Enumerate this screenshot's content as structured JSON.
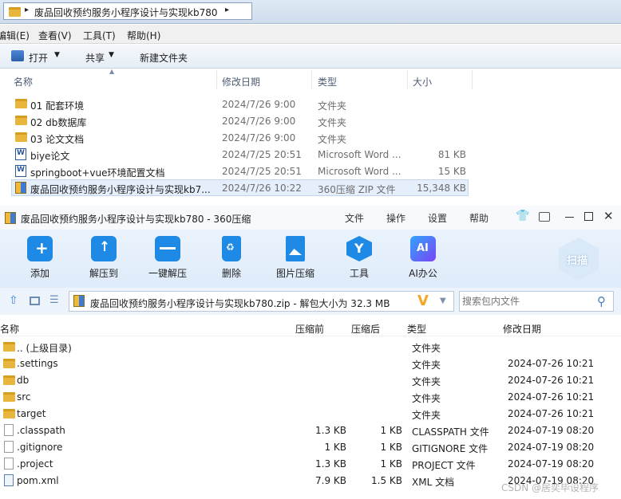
{
  "explorer": {
    "breadcrumb": "废品回收预约服务小程序设计与实现kb780",
    "menu": [
      "编辑(E)",
      "查看(V)",
      "工具(T)",
      "帮助(H)"
    ],
    "commands": {
      "open": "打开",
      "share": "共享",
      "new_folder": "新建文件夹"
    },
    "columns": {
      "name": "名称",
      "date": "修改日期",
      "type": "类型",
      "size": "大小"
    },
    "rows": [
      {
        "name": "01 配套环境",
        "date": "2024/7/26 9:00",
        "type": "文件夹",
        "size": "",
        "icon": "folder-icon"
      },
      {
        "name": "02 db数据库",
        "date": "2024/7/26 9:00",
        "type": "文件夹",
        "size": "",
        "icon": "folder-icon"
      },
      {
        "name": "03 论文文档",
        "date": "2024/7/26 9:00",
        "type": "文件夹",
        "size": "",
        "icon": "folder-icon"
      },
      {
        "name": "biye论文",
        "date": "2024/7/25 20:51",
        "type": "Microsoft Word ...",
        "size": "81 KB",
        "icon": "word-doc-icon"
      },
      {
        "name": "springboot+vue环境配置文档",
        "date": "2024/7/25 20:51",
        "type": "Microsoft Word ...",
        "size": "15 KB",
        "icon": "word-doc-icon"
      },
      {
        "name": "废品回收预约服务小程序设计与实现kb7...",
        "date": "2024/7/26 10:22",
        "type": "360压缩 ZIP 文件",
        "size": "15,348 KB",
        "icon": "zip-archive-icon"
      }
    ]
  },
  "zip": {
    "title": "废品回收预约服务小程序设计与实现kb780 - 360压缩",
    "tabs": [
      "文件",
      "操作",
      "设置",
      "帮助"
    ],
    "tools": [
      {
        "label": "添加",
        "icon": "add-icon",
        "color": "#1e8ae6"
      },
      {
        "label": "解压到",
        "icon": "extract-to-icon",
        "color": "#1e8ae6"
      },
      {
        "label": "一键解压",
        "icon": "one-click-extract-icon",
        "color": "#1e8ae6"
      },
      {
        "label": "删除",
        "icon": "delete-icon",
        "color": "#1e8ae6"
      },
      {
        "label": "图片压缩",
        "icon": "image-compress-icon",
        "color": "#1e8ae6"
      },
      {
        "label": "工具",
        "icon": "tools-icon",
        "color": "#1e8ae6"
      },
      {
        "label": "AI办公",
        "icon": "ai-office-icon",
        "color": "#6a4df0"
      }
    ],
    "scan_label": "扫描",
    "path_text": "废品回收预约服务小程序设计与实现kb780.zip - 解包大小为 32.3 MB",
    "search_placeholder": "搜索包内文件",
    "columns": {
      "name": "名称",
      "compressed_before": "压缩前",
      "compressed_after": "压缩后",
      "type": "类型",
      "date": "修改日期"
    },
    "rows": [
      {
        "name": ".. (上级目录)",
        "before": "",
        "after": "",
        "type": "文件夹",
        "date": "",
        "icon": "folder-icon"
      },
      {
        "name": ".settings",
        "before": "",
        "after": "",
        "type": "文件夹",
        "date": "2024-07-26 10:21",
        "icon": "folder-icon"
      },
      {
        "name": "db",
        "before": "",
        "after": "",
        "type": "文件夹",
        "date": "2024-07-26 10:21",
        "icon": "folder-icon"
      },
      {
        "name": "src",
        "before": "",
        "after": "",
        "type": "文件夹",
        "date": "2024-07-26 10:21",
        "icon": "folder-icon"
      },
      {
        "name": "target",
        "before": "",
        "after": "",
        "type": "文件夹",
        "date": "2024-07-26 10:21",
        "icon": "folder-icon"
      },
      {
        "name": ".classpath",
        "before": "1.3 KB",
        "after": "1 KB",
        "type": "CLASSPATH 文件",
        "date": "2024-07-19 08:20",
        "icon": "file-icon"
      },
      {
        "name": ".gitignore",
        "before": "1 KB",
        "after": "1 KB",
        "type": "GITIGNORE 文件",
        "date": "2024-07-19 08:20",
        "icon": "file-icon"
      },
      {
        "name": ".project",
        "before": "1.3 KB",
        "after": "1 KB",
        "type": "PROJECT 文件",
        "date": "2024-07-19 08:20",
        "icon": "file-icon"
      },
      {
        "name": "pom.xml",
        "before": "7.9 KB",
        "after": "1.5 KB",
        "type": "XML 文档",
        "date": "2024-07-19 08:20",
        "icon": "xml-file-icon"
      }
    ]
  },
  "watermark": "CSDN @居奕毕设程序"
}
